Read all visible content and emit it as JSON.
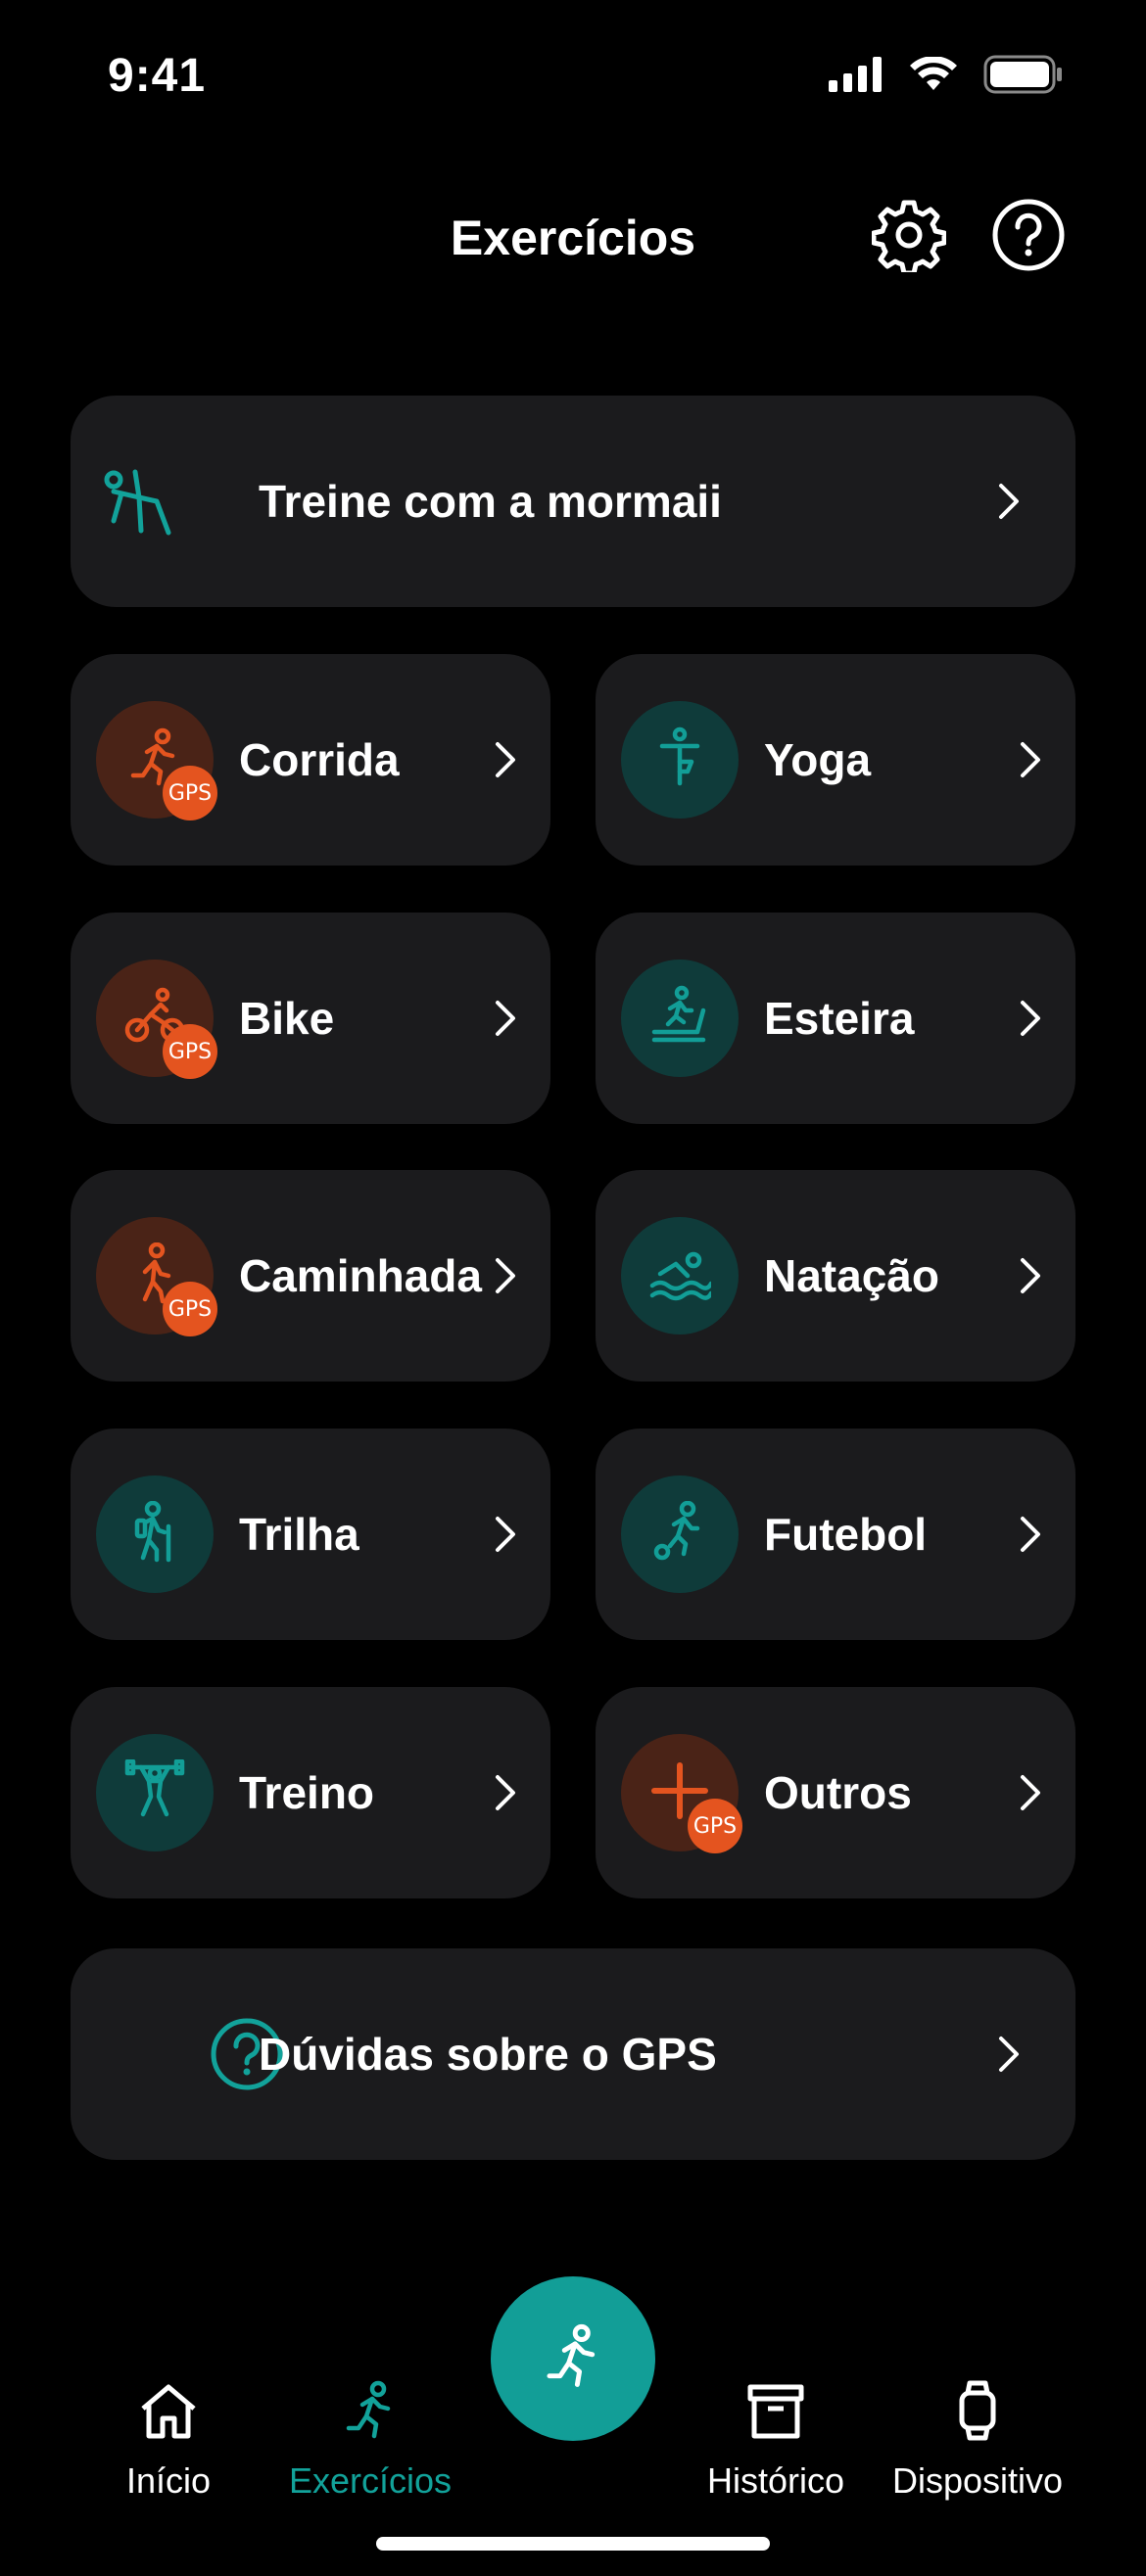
{
  "status_bar": {
    "time": "9:41"
  },
  "header": {
    "title": "Exercícios"
  },
  "train_card": {
    "label": "Treine com a mormaii",
    "icon": "stretch-person-icon"
  },
  "activities": [
    {
      "label": "Corrida",
      "icon": "running-icon",
      "theme": "orange",
      "gps": true
    },
    {
      "label": "Yoga",
      "icon": "yoga-icon",
      "theme": "teal",
      "gps": false
    },
    {
      "label": "Bike",
      "icon": "cycling-icon",
      "theme": "orange",
      "gps": true
    },
    {
      "label": "Esteira",
      "icon": "treadmill-icon",
      "theme": "teal",
      "gps": false
    },
    {
      "label": "Caminhada",
      "icon": "walking-icon",
      "theme": "orange",
      "gps": true
    },
    {
      "label": "Natação",
      "icon": "swimming-icon",
      "theme": "teal",
      "gps": false
    },
    {
      "label": "Trilha",
      "icon": "hiking-icon",
      "theme": "teal",
      "gps": false
    },
    {
      "label": "Futebol",
      "icon": "soccer-icon",
      "theme": "teal",
      "gps": false
    },
    {
      "label": "Treino",
      "icon": "weightlifting-icon",
      "theme": "teal",
      "gps": false
    },
    {
      "label": "Outros",
      "icon": "plus-icon",
      "theme": "orange",
      "gps": true
    }
  ],
  "gps_badge_text": "GPS",
  "gps_help_card": {
    "label": "Dúvidas sobre o GPS",
    "icon": "help-circle-icon"
  },
  "bottom_nav": {
    "items": [
      {
        "label": "Início",
        "icon": "home-icon",
        "active": false
      },
      {
        "label": "Exercícios",
        "icon": "running-icon",
        "active": true
      },
      {
        "label": "Histórico",
        "icon": "archive-icon",
        "active": false
      },
      {
        "label": "Dispositivo",
        "icon": "watch-icon",
        "active": false
      }
    ],
    "fab_icon": "running-icon"
  },
  "colors": {
    "accent_teal": "#129E97",
    "accent_orange": "#E4541F",
    "card_bg": "#1B1B1D",
    "background": "#000000"
  }
}
